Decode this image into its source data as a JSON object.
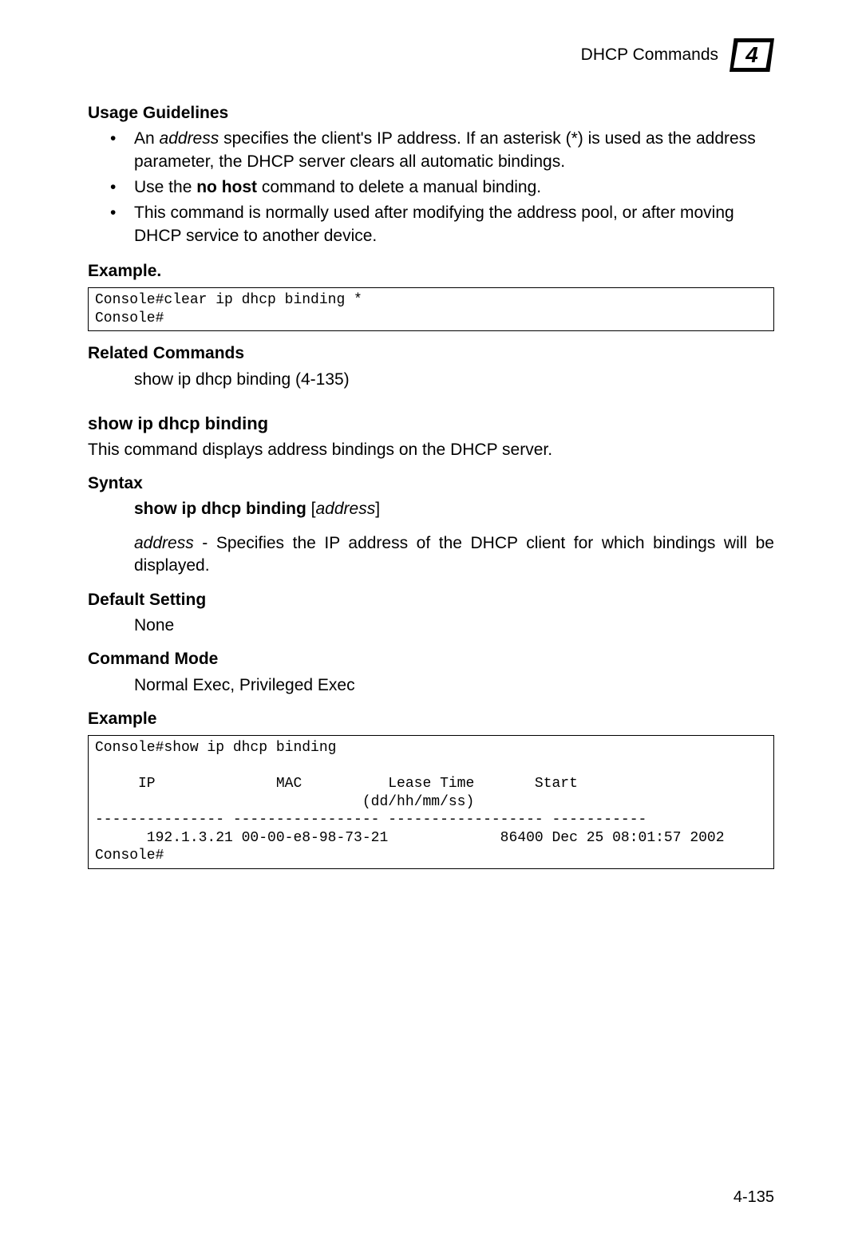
{
  "header": {
    "title": "DHCP Commands",
    "chapter_number": "4"
  },
  "usage": {
    "heading": "Usage Guidelines",
    "bullets": [
      {
        "pre": "An ",
        "em": "address",
        "post": " specifies the client's IP address. If an asterisk (*) is used as the address parameter, the DHCP server clears all automatic bindings."
      },
      {
        "pre": "Use the ",
        "strong": "no host",
        "post": " command to delete a manual binding."
      },
      {
        "plain": "This command is normally used after modifying the address pool, or after moving DHCP service to another device."
      }
    ]
  },
  "example1": {
    "heading": "Example.",
    "code": "Console#clear ip dhcp binding *\nConsole#"
  },
  "related": {
    "heading": "Related Commands",
    "text": "show ip dhcp binding (4-135)"
  },
  "show_cmd": {
    "heading": "show ip dhcp binding",
    "description": "This command displays address bindings on the DHCP server."
  },
  "syntax": {
    "heading": "Syntax",
    "line_strong": "show ip dhcp binding",
    "line_bracket_open": " [",
    "line_em": "address",
    "line_bracket_close": "]",
    "desc_em": "address",
    "desc_rest": " - Specifies the IP address of the DHCP client for which bindings will be displayed."
  },
  "default_setting": {
    "heading": "Default Setting",
    "text": "None"
  },
  "command_mode": {
    "heading": "Command Mode",
    "text": "Normal Exec, Privileged Exec"
  },
  "example2": {
    "heading": "Example",
    "code": "Console#show ip dhcp binding\n\n     IP              MAC          Lease Time       Start\n                               (dd/hh/mm/ss)\n--------------- ----------------- ------------------ -----------\n      192.1.3.21 00-00-e8-98-73-21             86400 Dec 25 08:01:57 2002\nConsole#"
  },
  "page_number": "4-135"
}
